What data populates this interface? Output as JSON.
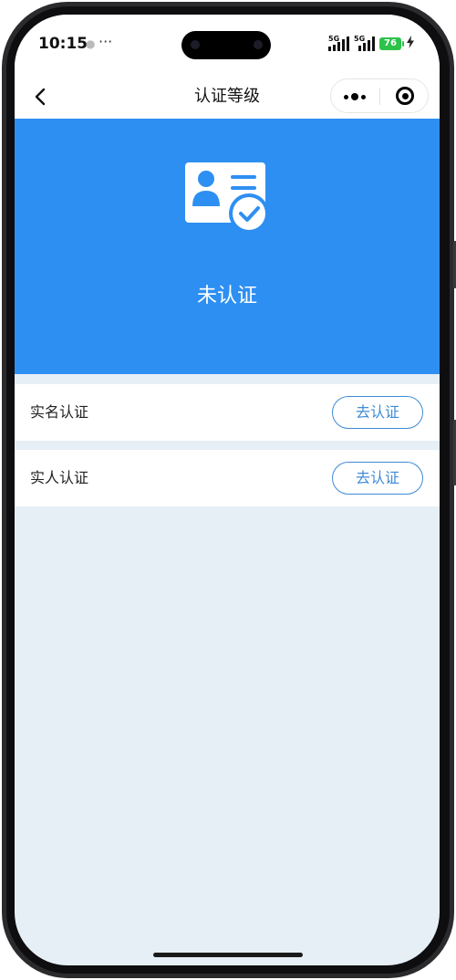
{
  "status_bar": {
    "time": "10:15",
    "separator": "●",
    "more": "···",
    "signal_1": "5G",
    "signal_2": "5G",
    "battery": "76",
    "charging_icon": "charging-bolt-icon"
  },
  "nav": {
    "title": "认证等级",
    "back_icon": "chevron-left-icon",
    "more_icon": "more-dots-icon",
    "close_icon": "target-close-icon"
  },
  "hero": {
    "icon": "id-card-verified-icon",
    "status": "未认证",
    "background": "#2e8ff2"
  },
  "items": [
    {
      "label": "实名认证",
      "button": "去认证"
    },
    {
      "label": "实人认证",
      "button": "去认证"
    }
  ],
  "colors": {
    "accent": "#3f8bd6",
    "page_bg": "#e6eef6",
    "battery": "#2dc24a"
  }
}
